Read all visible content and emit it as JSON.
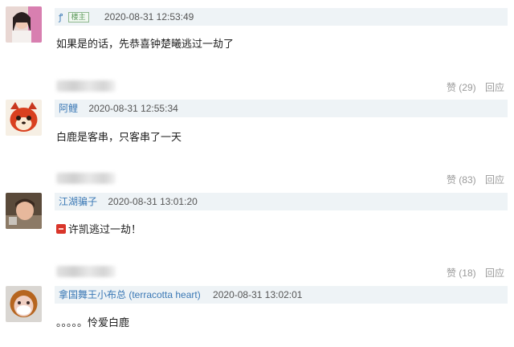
{
  "comments": [
    {
      "user": "",
      "owner_badge": "楼主",
      "time": "2020-08-31 12:53:49",
      "text": "如果是的话，先恭喜钟楚曦逃过一劫了",
      "likes_label": "赞 (29)",
      "reply_label": "回应"
    },
    {
      "user": "阿鲤",
      "time": "2020-08-31 12:55:34",
      "text": "白鹿是客串，只客串了一天",
      "likes_label": "赞 (83)",
      "reply_label": "回应"
    },
    {
      "user": "江湖骗子",
      "time": "2020-08-31 13:01:20",
      "text": "许凯逃过一劫！",
      "likes_label": "赞 (18)",
      "reply_label": "回应"
    },
    {
      "user": "拿国舞王小布总 (terracotta heart)",
      "time": "2020-08-31 13:02:01",
      "text": "。。。。。怜爱白鹿"
    }
  ],
  "icons": {
    "avatar_1": "girl-photo-avatar",
    "avatar_2": "red-cartoon-animal-avatar",
    "avatar_3": "child-photo-avatar",
    "avatar_4": "masked-person-avatar",
    "owner_mark": "vip-icon",
    "emoji_3": "red-emoji-icon"
  },
  "colors": {
    "header_bg": "#eef3f6",
    "username": "#3a78b5",
    "action_text": "#9a9a9a"
  }
}
